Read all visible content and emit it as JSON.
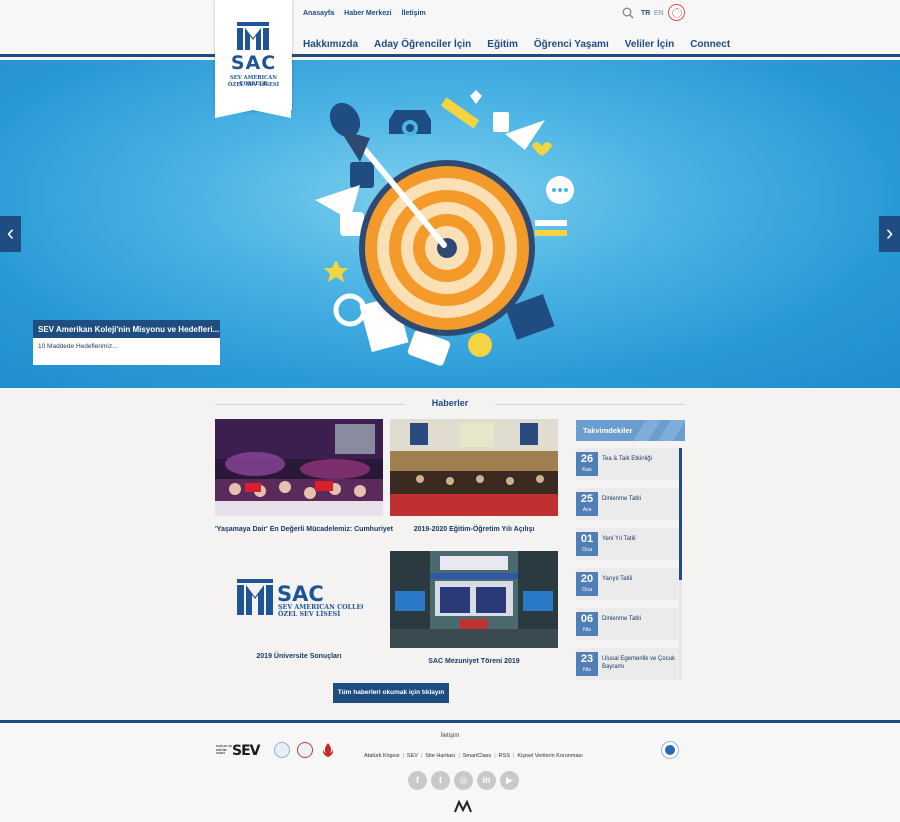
{
  "header": {
    "logo": {
      "name": "SAC",
      "line1": "SEV AMERICAN COLLEGE",
      "line2": "ÖZEL SEV LİSESİ"
    },
    "top_links": [
      "Anasayfa",
      "Haber Merkezi",
      "İletişim"
    ],
    "main_nav": [
      "Hakkımızda",
      "Aday Öğrenciler İçin",
      "Eğitim",
      "Öğrenci Yaşamı",
      "Veliler İçin",
      "Connect"
    ],
    "lang_tr": "TR",
    "lang_en": "EN"
  },
  "hero": {
    "caption_title": "SEV Amerikan Koleji'nin Misyonu ve Hedefleri...",
    "caption_text": "10 Maddede Hedeflerimiz...",
    "prev": "‹",
    "next": "›"
  },
  "news": {
    "title": "Haberler",
    "items": [
      {
        "caption": "'Yaşamaya Dair' En Değerli Mücadelemiz: Cumhuriyet"
      },
      {
        "caption": "2019-2020 Eğitim-Öğretim Yılı Açılışı"
      },
      {
        "caption": "2019 Üniversite Sonuçları"
      },
      {
        "caption": "SAC Mezuniyet Töreni 2019"
      }
    ],
    "all_button": "Tüm haberleri okumak için tıklayın"
  },
  "calendar": {
    "title": "Takvimdekiler",
    "items": [
      {
        "day": "26",
        "month": "Kas",
        "event": "Tea & Talk Etkinliği"
      },
      {
        "day": "25",
        "month": "Ara",
        "event": "Dinlenme Tatili"
      },
      {
        "day": "01",
        "month": "Oca",
        "event": "Yeni Yıl Tatili"
      },
      {
        "day": "20",
        "month": "Oca",
        "event": "Yarıyıl Tatili"
      },
      {
        "day": "06",
        "month": "Nis",
        "event": "Dinlenme Tatili"
      },
      {
        "day": "23",
        "month": "Nis",
        "event": "Ulusal Egemenlik ve Çocuk Bayramı"
      }
    ]
  },
  "footer": {
    "contact": "İletişim",
    "links": [
      "Atatürk Köşesi",
      "SEV",
      "Site Haritası",
      "SmartClass",
      "RSS",
      "Kişisel Verilerin Korunması"
    ],
    "sev_brand": "SEV",
    "sev_small": [
      "SAĞLIK VE",
      "EĞİTİM",
      "VAKFI"
    ],
    "social": [
      "f",
      "t",
      "◎",
      "in",
      "▶"
    ]
  },
  "colors": {
    "primary": "#1f4d82",
    "calendar_date": "#4f7fb6",
    "hero_blue": "#2a9ad6"
  }
}
